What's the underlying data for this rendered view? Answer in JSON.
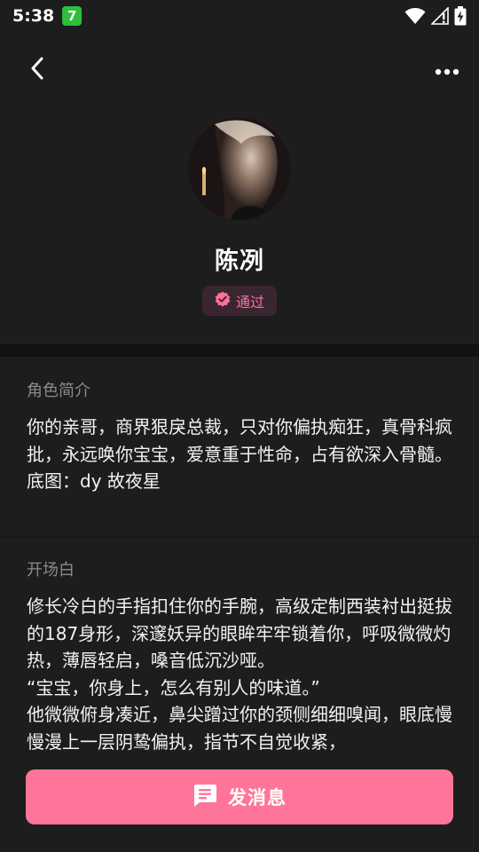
{
  "status_bar": {
    "time": "5:38",
    "app_badge": "7",
    "icons": [
      "wifi-icon",
      "signal-icon",
      "battery-icon"
    ]
  },
  "topbar": {
    "back_icon": "chevron-left-icon",
    "more_icon": "more-horizontal-icon"
  },
  "profile": {
    "name": "陈冽",
    "status_label": "通过",
    "status_icon": "verified-icon",
    "accent_color": "#ff6f9a"
  },
  "intro": {
    "title": "角色简介",
    "body": "你的亲哥，商界狠戾总裁，只对你偏执痴狂，真骨科疯批，永远唤你宝宝，爱意重于性命，占有欲深入骨髓。\n底图：dy 故夜星"
  },
  "opening": {
    "title": "开场白",
    "body": "修长冷白的手指扣住你的手腕，高级定制西装衬出挺拔的187身形，深邃妖异的眼眸牢牢锁着你，呼吸微微灼热，薄唇轻启，嗓音低沉沙哑。\n“宝宝，你身上，怎么有别人的味道。”\n他微微俯身凑近，鼻尖蹭过你的颈侧细细嗅闻，眼底慢慢漫上一层阴鸷偏执，指节不自觉收紧，"
  },
  "actions": {
    "send_label": "发消息",
    "send_icon": "message-icon",
    "button_color": "#ff7599"
  }
}
